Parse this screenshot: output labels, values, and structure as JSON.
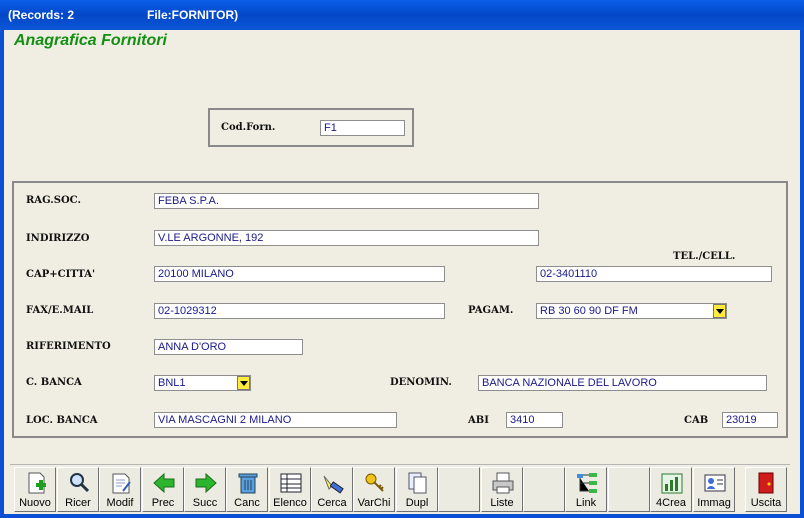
{
  "titlebar": {
    "records": "(Records: 2",
    "file": "File:FORNITOR)"
  },
  "heading": "Anagrafica Fornitori",
  "code_box": {
    "label": "Cod.Forn.",
    "value": "F1"
  },
  "form": {
    "rag_soc": {
      "label": "RAG.SOC.",
      "value": "FEBA S.P.A."
    },
    "indirizzo": {
      "label": "INDIRIZZO",
      "value": "V.LE ARGONNE, 192"
    },
    "cap_citta": {
      "label": "CAP+CITTA'",
      "value": "20100 MILANO"
    },
    "tel": {
      "label": "TEL./CELL.",
      "value": "02-3401110"
    },
    "fax": {
      "label": "FAX/E.MAIL",
      "value": "02-1029312"
    },
    "pagam": {
      "label": "PAGAM.",
      "value": "RB 30 60 90 DF FM"
    },
    "riferimento": {
      "label": "RIFERIMENTO",
      "value": "ANNA D'ORO"
    },
    "banca": {
      "label": "C. BANCA",
      "value": "BNL1"
    },
    "denomin": {
      "label": "DENOMIN.",
      "value": "BANCA NAZIONALE DEL LAVORO"
    },
    "loc_banca": {
      "label": "LOC. BANCA",
      "value": "VIA MASCAGNI 2  MILANO"
    },
    "abi": {
      "label": "ABI",
      "value": "3410"
    },
    "cab": {
      "label": "CAB",
      "value": "23019"
    }
  },
  "toolbar": {
    "nuovo": "Nuovo",
    "ricer": "Ricer",
    "modif": "Modif",
    "prec": "Prec",
    "succ": "Succ",
    "canc": "Canc",
    "elenco": "Elenco",
    "cerca": "Cerca",
    "varchi": "VarChi",
    "dupl": "Dupl",
    "liste": "Liste",
    "link": "Link",
    "crea4": "4Crea",
    "immag": "Immag",
    "uscita": "Uscita"
  },
  "colors": {
    "title_bar": "#0a5fe8",
    "heading": "#138f13",
    "field_text": "#1a1a8c",
    "dropdown": "#ffeb3b"
  }
}
